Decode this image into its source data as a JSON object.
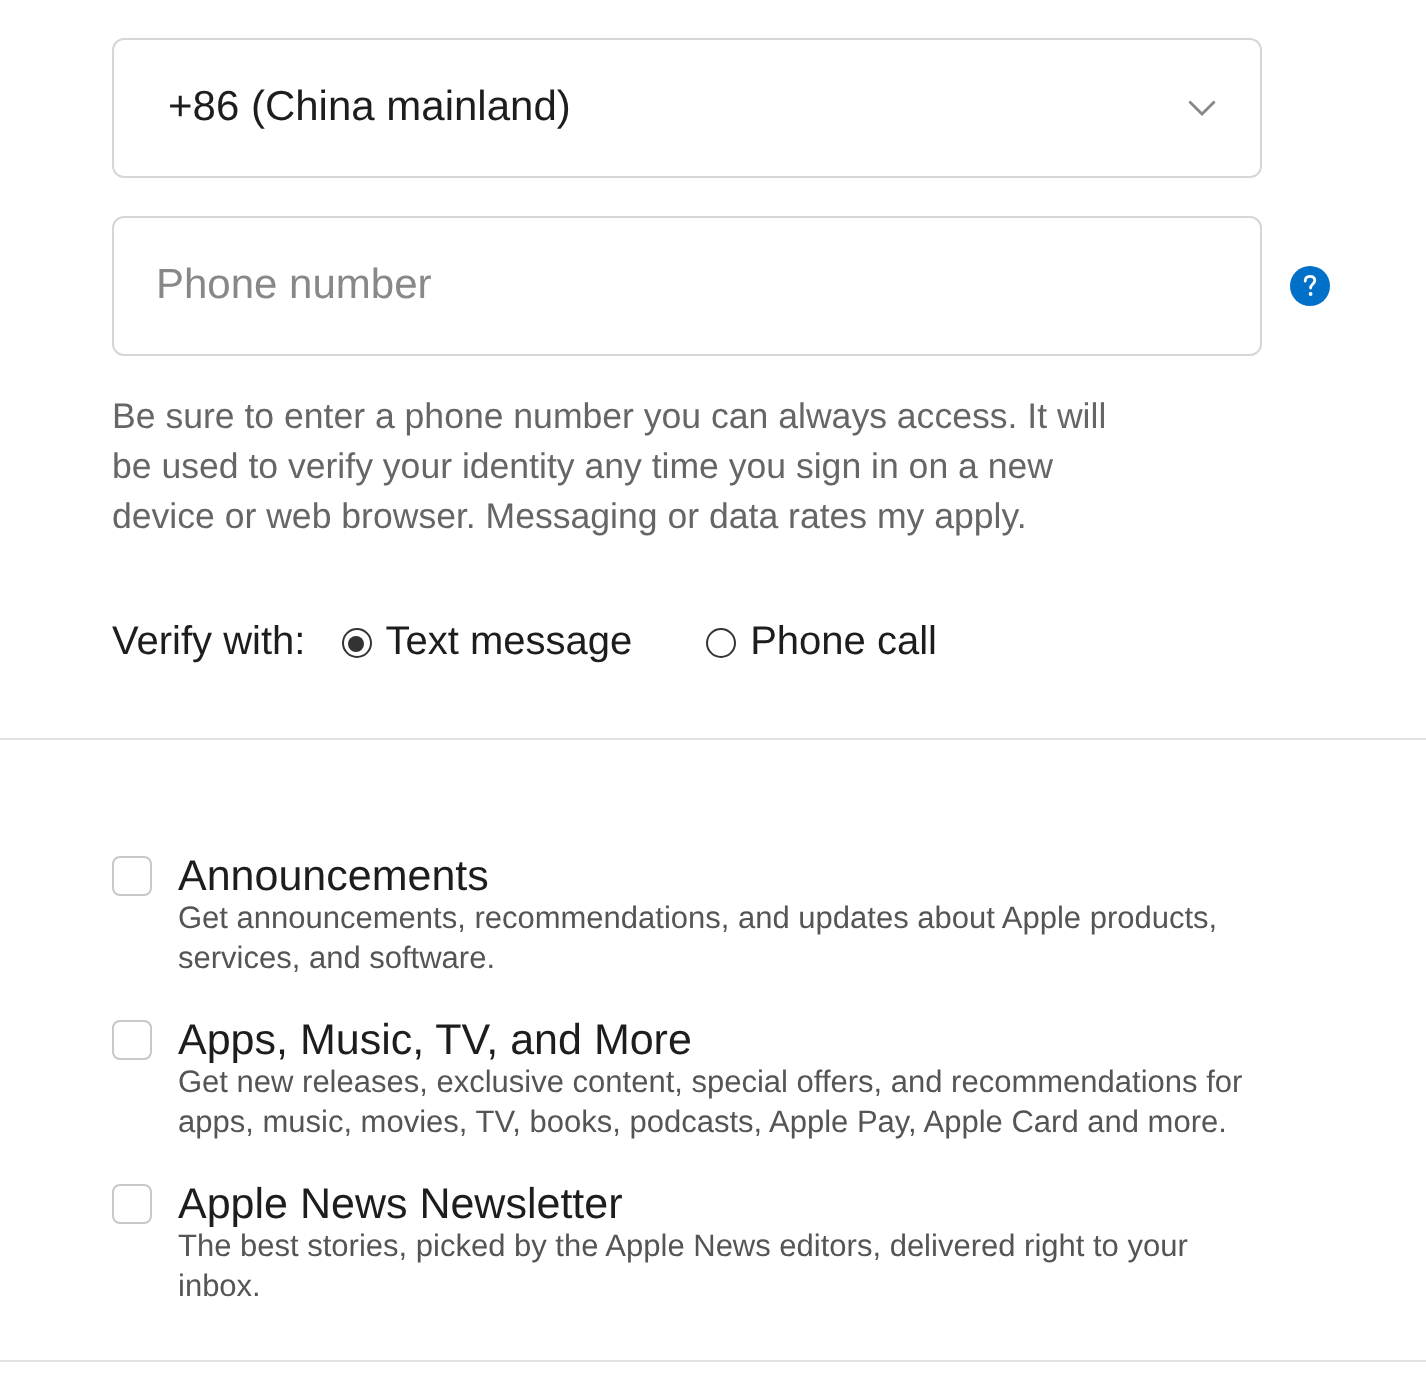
{
  "country_select": {
    "value": "+86 (China mainland)"
  },
  "phone_field": {
    "placeholder": "Phone number"
  },
  "help_text": "Be sure to enter a phone number you can always access. It will be used to verify your identity any time you sign in on a new device or web browser. Messaging or data rates my apply.",
  "verify": {
    "label": "Verify with:",
    "options": [
      {
        "label": "Text message",
        "selected": true
      },
      {
        "label": "Phone call",
        "selected": false
      }
    ]
  },
  "subscriptions": [
    {
      "title": "Announcements",
      "description": "Get announcements, recommendations, and updates about Apple products, services, and software.",
      "checked": false
    },
    {
      "title": "Apps, Music, TV, and More",
      "description": "Get new releases, exclusive content, special offers, and recommendations for apps, music, movies, TV, books, podcasts, Apple Pay, Apple Card and more.",
      "checked": false
    },
    {
      "title": "Apple News Newsletter",
      "description": "The best stories, picked by the Apple News editors, delivered right to your inbox.",
      "checked": false
    }
  ]
}
